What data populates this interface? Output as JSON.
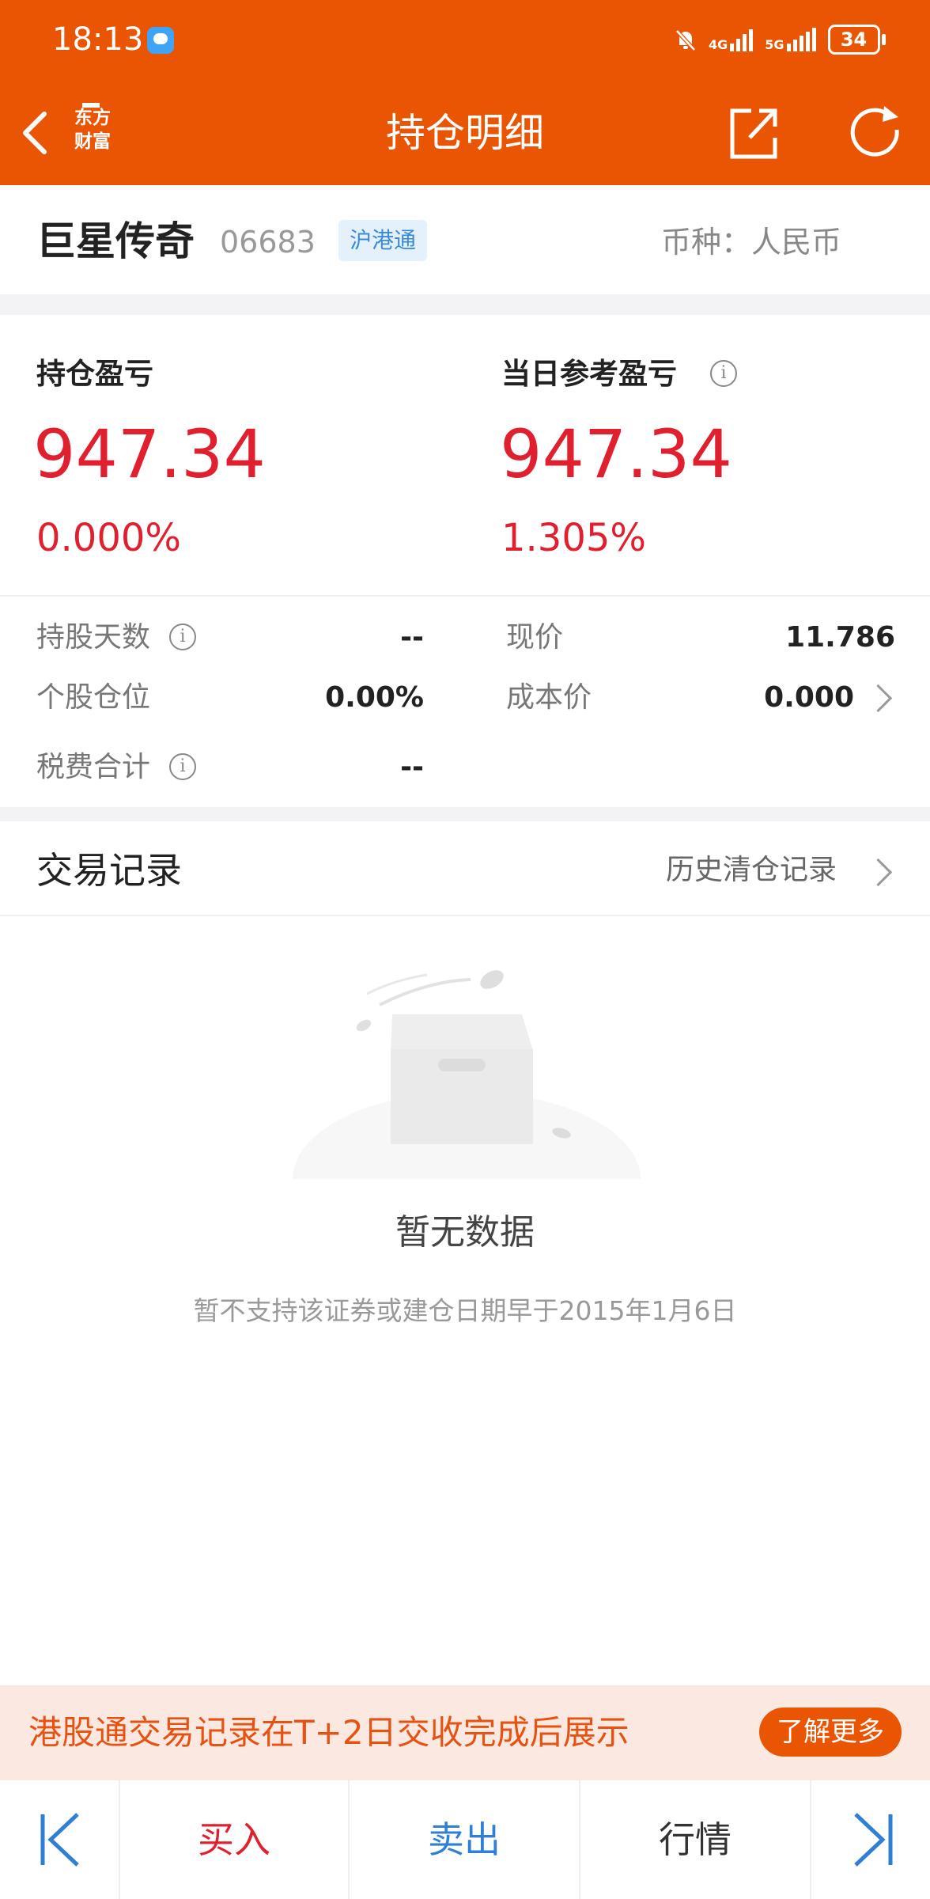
{
  "status_bar": {
    "time": "18:13",
    "network_1": "4G",
    "network_2": "5G",
    "battery": "34"
  },
  "nav": {
    "title": "持仓明细",
    "logo_line1": "东方",
    "logo_line2": "财富",
    "icons": [
      "back-arrow-icon",
      "share-icon",
      "refresh-icon"
    ]
  },
  "stock": {
    "name": "巨星传奇",
    "code": "06683",
    "tag": "沪港通",
    "currency": "币种：人民币"
  },
  "position": {
    "left": {
      "label": "持仓盈亏",
      "value": "947.34",
      "pct": "0.000%"
    },
    "right": {
      "label": "当日参考盈亏",
      "value": "947.34",
      "pct": "1.305%"
    }
  },
  "details": {
    "hold_days_label": "持股天数",
    "hold_days_value": "--",
    "price_label": "现价",
    "price_value": "11.786",
    "position_ratio_label": "个股仓位",
    "position_ratio_value": "0.00%",
    "cost_label": "成本价",
    "cost_value": "0.000",
    "fees_label": "税费合计",
    "fees_value": "--"
  },
  "trade_records": {
    "title": "交易记录",
    "history_link": "历史清仓记录",
    "empty_title": "暂无数据",
    "empty_sub": "暂不支持该证券或建仓日期早于2015年1月6日"
  },
  "banner": {
    "text": "港股通交易记录在T+2日交收完成后展示",
    "button": "了解更多"
  },
  "toolbar": {
    "buy": "买入",
    "sell": "卖出",
    "quote": "行情"
  },
  "colors": {
    "brand": "#ea5504",
    "profit_red": "#e0202f",
    "sell_blue": "#2f7fd6",
    "tag_blue": "#3a8ad8"
  }
}
